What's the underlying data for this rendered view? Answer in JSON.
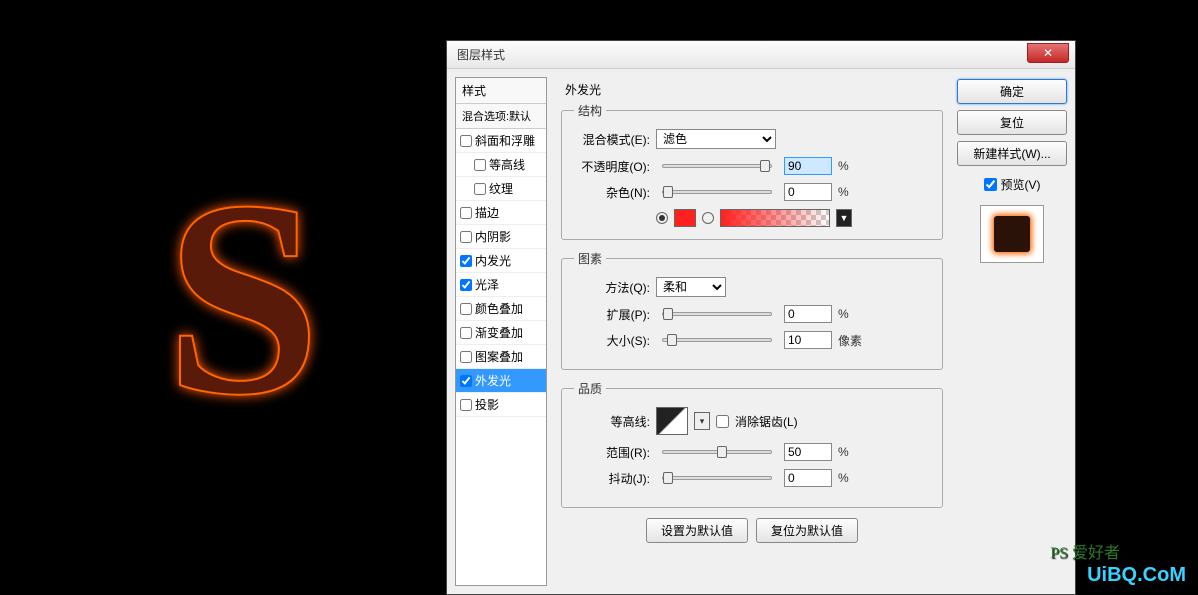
{
  "dialog": {
    "title": "图层样式",
    "close": "✕"
  },
  "styles": {
    "header": "样式",
    "blend_default": "混合选项:默认",
    "items": [
      {
        "label": "斜面和浮雕",
        "checked": false
      },
      {
        "label": "等高线",
        "checked": false,
        "indent": true
      },
      {
        "label": "纹理",
        "checked": false,
        "indent": true
      },
      {
        "label": "描边",
        "checked": false
      },
      {
        "label": "内阴影",
        "checked": false
      },
      {
        "label": "内发光",
        "checked": true
      },
      {
        "label": "光泽",
        "checked": true
      },
      {
        "label": "颜色叠加",
        "checked": false
      },
      {
        "label": "渐变叠加",
        "checked": false
      },
      {
        "label": "图案叠加",
        "checked": false
      },
      {
        "label": "外发光",
        "checked": true,
        "selected": true
      },
      {
        "label": "投影",
        "checked": false
      }
    ]
  },
  "panel": {
    "title": "外发光",
    "structure_legend": "结构",
    "blend_mode_label": "混合模式(E):",
    "blend_mode_value": "滤色",
    "opacity_label": "不透明度(O):",
    "opacity_value": "90",
    "noise_label": "杂色(N):",
    "noise_value": "0",
    "elements_legend": "图素",
    "technique_label": "方法(Q):",
    "technique_value": "柔和",
    "spread_label": "扩展(P):",
    "spread_value": "0",
    "size_label": "大小(S):",
    "size_value": "10",
    "size_unit": "像素",
    "quality_legend": "品质",
    "contour_label": "等高线:",
    "antialias_label": "消除锯齿(L)",
    "range_label": "范围(R):",
    "range_value": "50",
    "jitter_label": "抖动(J):",
    "jitter_value": "0",
    "percent": "%",
    "set_default": "设置为默认值",
    "reset_default": "复位为默认值"
  },
  "right": {
    "ok": "确定",
    "cancel": "复位",
    "new_style": "新建样式(W)...",
    "preview": "预览(V)"
  },
  "watermark": "UiBQ.CoM",
  "watermark2": "PS 爱好者"
}
